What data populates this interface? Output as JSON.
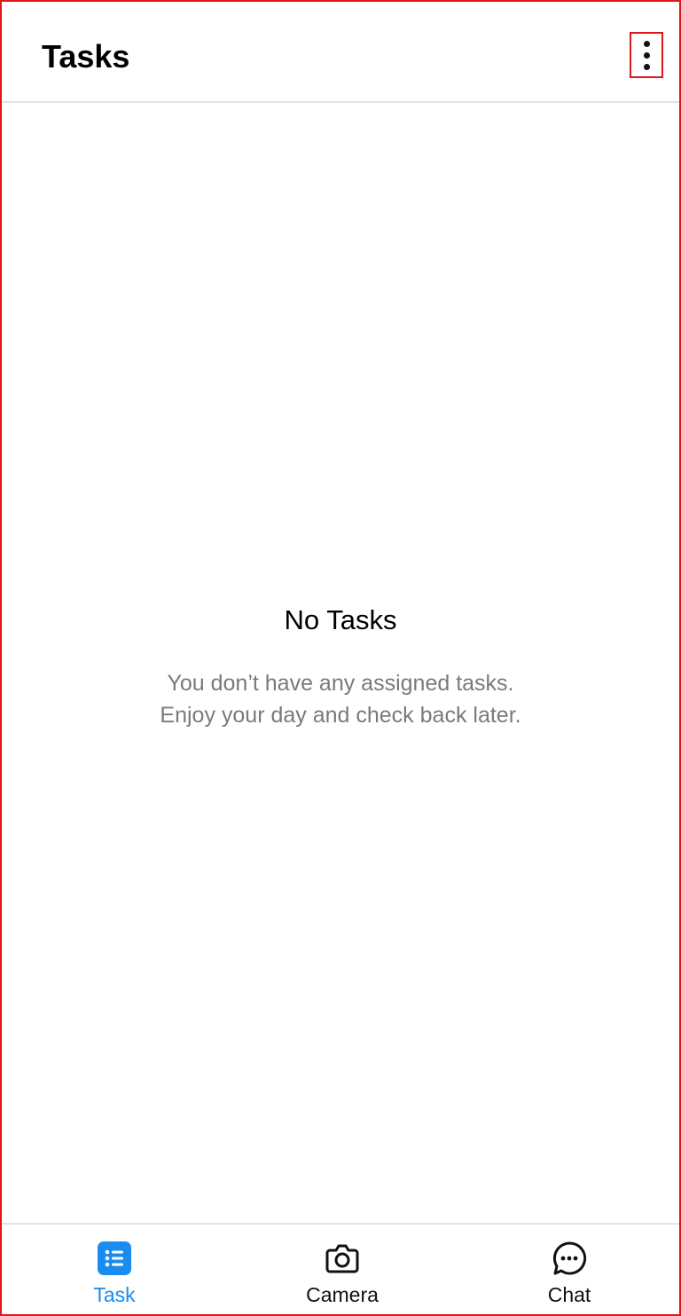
{
  "header": {
    "title": "Tasks",
    "menu_icon": "more-vertical-icon"
  },
  "empty_state": {
    "title": "No Tasks",
    "line1": "You don’t have any assigned tasks.",
    "line2": "Enjoy your day and check back later."
  },
  "bottom_nav": {
    "items": [
      {
        "label": "Task",
        "icon": "task-list-icon",
        "active": true
      },
      {
        "label": "Camera",
        "icon": "camera-icon",
        "active": false
      },
      {
        "label": "Chat",
        "icon": "chat-icon",
        "active": false
      }
    ]
  },
  "colors": {
    "accent": "#1a8cf0",
    "highlight_border": "#e0161b",
    "muted_text": "#7a7a7a"
  }
}
